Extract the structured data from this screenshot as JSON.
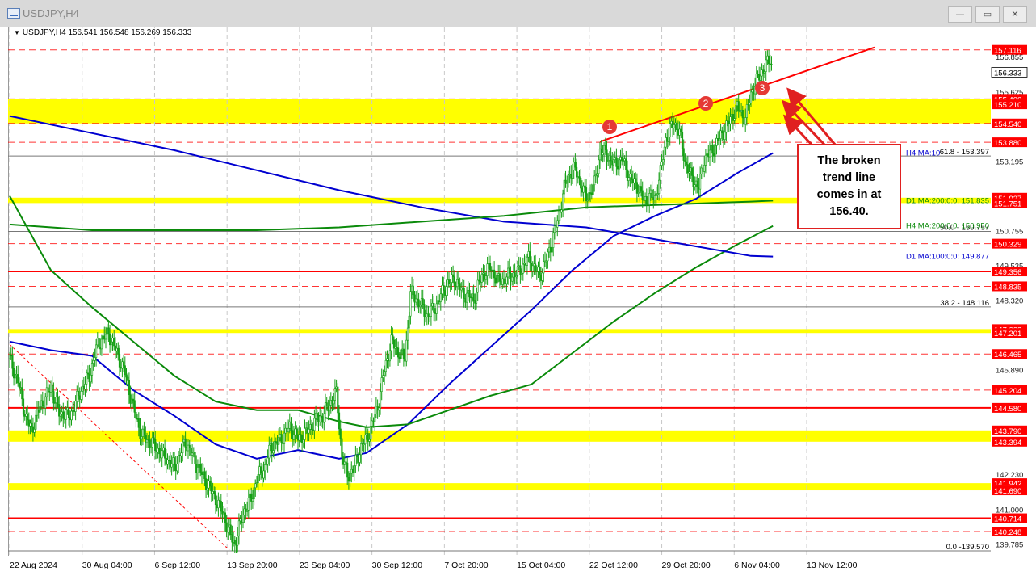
{
  "window": {
    "title": "USDJPY,H4",
    "buttons": {
      "minimize": "—",
      "restore": "▭",
      "close": "✕"
    }
  },
  "chart_header": {
    "symbol": "USDJPY,H4",
    "ohlc": "156.541 156.548 156.269 156.333"
  },
  "callout": {
    "line1": "The broken",
    "line2": "trend line",
    "line3": "comes in at",
    "line4": "156.40."
  },
  "markers": [
    "1",
    "2",
    "3"
  ],
  "colors": {
    "candle": "#16a016",
    "support_zone": "#ffff00",
    "resistance_line": "#ff0000",
    "ma_blue": "#0000d0",
    "ma_green": "#0a8a0a",
    "callout_border": "#e02020",
    "current_price_bg": "#ffffff"
  },
  "chart_data": {
    "type": "line",
    "instrument": "USDJPY",
    "timeframe": "H4",
    "ylim": [
      139.4,
      157.9
    ],
    "x_ticks": [
      "22 Aug 2024",
      "30 Aug 04:00",
      "6 Sep 12:00",
      "13 Sep 20:00",
      "23 Sep 04:00",
      "30 Sep 12:00",
      "7 Oct 20:00",
      "15 Oct 04:00",
      "22 Oct 12:00",
      "29 Oct 20:00",
      "6 Nov 04:00",
      "13 Nov 12:00"
    ],
    "y_ticks": [
      "156.855",
      "155.625",
      "153.195",
      "150.755",
      "149.535",
      "148.320",
      "145.890",
      "142.230",
      "141.000",
      "139.785"
    ],
    "current_price": "156.333",
    "price_labels": [
      {
        "value": 157.116,
        "label": "157.116"
      },
      {
        "value": 155.4,
        "label": "155.400"
      },
      {
        "value": 155.21,
        "label": "155.210"
      },
      {
        "value": 154.54,
        "label": "154.540"
      },
      {
        "value": 153.88,
        "label": "153.880"
      },
      {
        "value": 151.937,
        "label": "151.937"
      },
      {
        "value": 151.751,
        "label": "151.751"
      },
      {
        "value": 150.329,
        "label": "150.329"
      },
      {
        "value": 149.356,
        "label": "149.356"
      },
      {
        "value": 148.835,
        "label": "148.835"
      },
      {
        "value": 147.338,
        "label": "147.338"
      },
      {
        "value": 147.201,
        "label": "147.201"
      },
      {
        "value": 146.465,
        "label": "146.465"
      },
      {
        "value": 145.204,
        "label": "145.204"
      },
      {
        "value": 144.58,
        "label": "144.580"
      },
      {
        "value": 143.79,
        "label": "143.790"
      },
      {
        "value": 143.394,
        "label": "143.394"
      },
      {
        "value": 141.942,
        "label": "141.942"
      },
      {
        "value": 141.69,
        "label": "141.690"
      },
      {
        "value": 140.714,
        "label": "140.714"
      },
      {
        "value": 140.248,
        "label": "140.248"
      }
    ],
    "horizontal_lines": [
      {
        "value": 157.116,
        "style": "dashed"
      },
      {
        "value": 155.4,
        "style": "dashed"
      },
      {
        "value": 154.54,
        "style": "dashed"
      },
      {
        "value": 153.88,
        "style": "dashed"
      },
      {
        "value": 150.329,
        "style": "dashed"
      },
      {
        "value": 149.356,
        "style": "solid"
      },
      {
        "value": 148.835,
        "style": "dashed"
      },
      {
        "value": 146.465,
        "style": "dashed"
      },
      {
        "value": 145.204,
        "style": "dashed"
      },
      {
        "value": 144.58,
        "style": "solid"
      },
      {
        "value": 140.714,
        "style": "solid"
      },
      {
        "value": 140.248,
        "style": "dashed"
      }
    ],
    "zones": [
      {
        "from": 154.54,
        "to": 155.4
      },
      {
        "from": 151.751,
        "to": 151.937
      },
      {
        "from": 147.201,
        "to": 147.338
      },
      {
        "from": 143.394,
        "to": 143.79
      },
      {
        "from": 141.69,
        "to": 141.942
      }
    ],
    "fib_levels": [
      {
        "label": "61.8 - 153.397",
        "value": 153.397
      },
      {
        "label": "50.0 - 150.757",
        "value": 150.757
      },
      {
        "label": "38.2 - 148.116",
        "value": 148.116
      },
      {
        "label": "0.0 -139.570",
        "value": 139.57
      }
    ],
    "ma_labels": [
      {
        "label": "H4 MA:10",
        "value": 153.5
      },
      {
        "label": "D1 MA:200:0:0: 151.835",
        "value": 151.835
      },
      {
        "label": "H4 MA:200:0:0: 150.950",
        "value": 150.95
      },
      {
        "label": "D1 MA:100:0:0: 149.877",
        "value": 149.877
      }
    ],
    "series": [
      {
        "type": "candles",
        "close_path": [
          [
            0,
            146.3
          ],
          [
            6,
            145.5
          ],
          [
            12,
            144.2
          ],
          [
            16,
            143.8
          ],
          [
            22,
            144.6
          ],
          [
            30,
            145.3
          ],
          [
            36,
            144.4
          ],
          [
            44,
            144.3
          ],
          [
            52,
            145.2
          ],
          [
            58,
            145.7
          ],
          [
            64,
            146.8
          ],
          [
            72,
            147.2
          ],
          [
            78,
            146.5
          ],
          [
            84,
            145.8
          ],
          [
            90,
            144.6
          ],
          [
            96,
            143.6
          ],
          [
            104,
            143.3
          ],
          [
            112,
            142.9
          ],
          [
            120,
            142.5
          ],
          [
            128,
            143.4
          ],
          [
            136,
            142.6
          ],
          [
            144,
            141.9
          ],
          [
            150,
            141.4
          ],
          [
            156,
            140.8
          ],
          [
            160,
            140.2
          ],
          [
            164,
            139.8
          ],
          [
            170,
            140.9
          ],
          [
            176,
            141.4
          ],
          [
            180,
            142.1
          ],
          [
            186,
            142.5
          ],
          [
            190,
            143.2
          ],
          [
            196,
            143.4
          ],
          [
            204,
            143.9
          ],
          [
            210,
            143.5
          ],
          [
            216,
            143.7
          ],
          [
            222,
            144.1
          ],
          [
            228,
            144.3
          ],
          [
            234,
            144.8
          ],
          [
            238,
            145.1
          ],
          [
            240,
            144.0
          ],
          [
            242,
            142.9
          ],
          [
            246,
            142.2
          ],
          [
            250,
            142.4
          ],
          [
            256,
            143.2
          ],
          [
            262,
            143.7
          ],
          [
            268,
            144.6
          ],
          [
            272,
            145.7
          ],
          [
            278,
            146.9
          ],
          [
            282,
            146.6
          ],
          [
            288,
            146.3
          ],
          [
            292,
            148.6
          ],
          [
            298,
            148.3
          ],
          [
            304,
            147.8
          ],
          [
            310,
            148.1
          ],
          [
            318,
            148.9
          ],
          [
            324,
            149.1
          ],
          [
            330,
            148.6
          ],
          [
            338,
            148.4
          ],
          [
            344,
            149.2
          ],
          [
            350,
            149.5
          ],
          [
            356,
            149.0
          ],
          [
            364,
            149.2
          ],
          [
            370,
            149.3
          ],
          [
            378,
            149.8
          ],
          [
            382,
            149.5
          ],
          [
            386,
            149.2
          ],
          [
            392,
            149.9
          ],
          [
            396,
            150.6
          ],
          [
            400,
            151.3
          ],
          [
            404,
            152.3
          ],
          [
            410,
            153.0
          ],
          [
            414,
            152.7
          ],
          [
            420,
            151.9
          ],
          [
            426,
            152.4
          ],
          [
            430,
            153.6
          ],
          [
            436,
            153.4
          ],
          [
            440,
            153.1
          ],
          [
            446,
            153.3
          ],
          [
            452,
            152.6
          ],
          [
            458,
            152.3
          ],
          [
            462,
            151.8
          ],
          [
            466,
            152.0
          ],
          [
            470,
            151.9
          ],
          [
            474,
            152.8
          ],
          [
            478,
            154.0
          ],
          [
            484,
            154.6
          ],
          [
            488,
            154.2
          ],
          [
            492,
            153.2
          ],
          [
            496,
            152.7
          ],
          [
            502,
            152.3
          ],
          [
            506,
            153.3
          ],
          [
            512,
            153.6
          ],
          [
            518,
            154.1
          ],
          [
            524,
            154.6
          ],
          [
            530,
            155.1
          ],
          [
            536,
            154.7
          ],
          [
            540,
            155.6
          ],
          [
            546,
            156.2
          ],
          [
            550,
            156.5
          ],
          [
            554,
            156.8
          ],
          [
            556,
            156.333
          ]
        ]
      },
      {
        "name": "H4 MA:10",
        "color": "blue",
        "path": [
          [
            0,
            146.9
          ],
          [
            30,
            146.6
          ],
          [
            60,
            146.4
          ],
          [
            90,
            145.2
          ],
          [
            120,
            144.3
          ],
          [
            150,
            143.3
          ],
          [
            180,
            142.8
          ],
          [
            210,
            143.1
          ],
          [
            240,
            142.8
          ],
          [
            260,
            143.0
          ],
          [
            290,
            144.0
          ],
          [
            320,
            145.4
          ],
          [
            350,
            146.7
          ],
          [
            380,
            148.0
          ],
          [
            410,
            149.4
          ],
          [
            440,
            150.6
          ],
          [
            470,
            151.3
          ],
          [
            500,
            151.9
          ],
          [
            530,
            152.8
          ],
          [
            556,
            153.5
          ]
        ]
      },
      {
        "name": "H4 MA:200",
        "color": "green",
        "path": [
          [
            0,
            152.0
          ],
          [
            30,
            149.4
          ],
          [
            60,
            148.1
          ],
          [
            90,
            146.9
          ],
          [
            120,
            145.7
          ],
          [
            150,
            144.8
          ],
          [
            180,
            144.5
          ],
          [
            210,
            144.5
          ],
          [
            240,
            144.1
          ],
          [
            260,
            143.9
          ],
          [
            290,
            144.0
          ],
          [
            320,
            144.5
          ],
          [
            350,
            145.0
          ],
          [
            380,
            145.4
          ],
          [
            410,
            146.5
          ],
          [
            440,
            147.6
          ],
          [
            470,
            148.6
          ],
          [
            500,
            149.5
          ],
          [
            530,
            150.3
          ],
          [
            556,
            150.95
          ]
        ]
      },
      {
        "name": "D1 MA:100",
        "color": "blue",
        "path": [
          [
            0,
            154.8
          ],
          [
            60,
            154.2
          ],
          [
            120,
            153.6
          ],
          [
            180,
            152.9
          ],
          [
            240,
            152.2
          ],
          [
            300,
            151.6
          ],
          [
            360,
            151.1
          ],
          [
            420,
            150.9
          ],
          [
            480,
            150.4
          ],
          [
            540,
            149.9
          ],
          [
            556,
            149.877
          ]
        ]
      },
      {
        "name": "D1 MA:200",
        "color": "green",
        "path": [
          [
            0,
            151.0
          ],
          [
            60,
            150.8
          ],
          [
            120,
            150.8
          ],
          [
            180,
            150.8
          ],
          [
            240,
            150.9
          ],
          [
            300,
            151.1
          ],
          [
            360,
            151.3
          ],
          [
            420,
            151.6
          ],
          [
            480,
            151.7
          ],
          [
            540,
            151.8
          ],
          [
            556,
            151.835
          ]
        ]
      },
      {
        "name": "trend-line",
        "color": "red",
        "path": [
          [
            430,
            153.9
          ],
          [
            630,
            157.2
          ]
        ]
      },
      {
        "name": "diagonal-dotted",
        "color": "red",
        "path": [
          [
            0,
            146.8
          ],
          [
            160,
            139.6
          ]
        ]
      }
    ],
    "marker_points": [
      {
        "label": "1",
        "at": [
          430,
          154.1
        ]
      },
      {
        "label": "2",
        "at": [
          492,
          155.1
        ]
      },
      {
        "label": "3",
        "at": [
          534,
          155.6
        ]
      }
    ]
  }
}
